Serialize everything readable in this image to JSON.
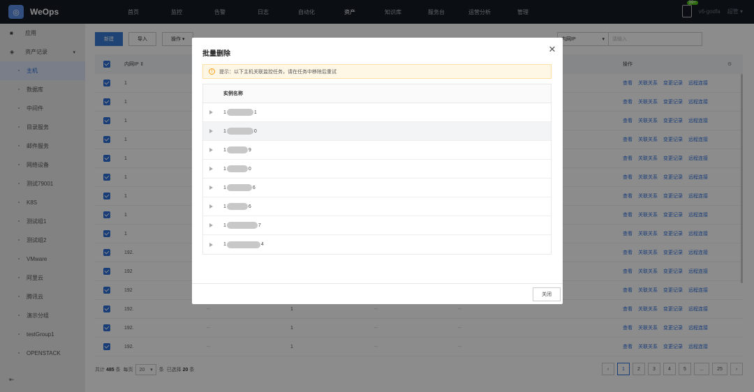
{
  "app": {
    "name": "WeOps"
  },
  "nav": [
    "首页",
    "监控",
    "告警",
    "日志",
    "自动化",
    "资产",
    "知识库",
    "服务台",
    "运营分析",
    "管理"
  ],
  "nav_active_index": 5,
  "topbar": {
    "badge": "99+",
    "user": "v6-godfa",
    "admin": "超管"
  },
  "sidebar": {
    "apps": "应用",
    "group": "资产记录",
    "items": [
      "主机",
      "数据库",
      "中间件",
      "目录服务",
      "邮件服务",
      "网络设备",
      "测试79001",
      "K8S",
      "测试组1",
      "测试组2",
      "VMware",
      "阿里云",
      "腾讯云",
      "演示分组",
      "testGroup1",
      "OPENSTACK"
    ],
    "active_index": 0
  },
  "toolbar": {
    "new": "新建",
    "import": "导入",
    "ops": "操作"
  },
  "filter": {
    "field": "内网IP",
    "placeholder": "请输入"
  },
  "table": {
    "col_ip": "内网IP",
    "col_op": "操作",
    "ops": [
      "查看",
      "关联关系",
      "变更记录",
      "远程连接"
    ],
    "rows": [
      {
        "ip": "1",
        "c3": "",
        "c4": "",
        "c5": "",
        "c6": ""
      },
      {
        "ip": "1",
        "c3": "",
        "c4": "",
        "c5": "",
        "c6": ""
      },
      {
        "ip": "1",
        "c3": "",
        "c4": "",
        "c5": "",
        "c6": ""
      },
      {
        "ip": "1",
        "c3": "",
        "c4": "",
        "c5": "",
        "c6": ""
      },
      {
        "ip": "1",
        "c3": "",
        "c4": "",
        "c5": "",
        "c6": ""
      },
      {
        "ip": "1",
        "c3": "",
        "c4": "",
        "c5": "",
        "c6": ""
      },
      {
        "ip": "1",
        "c3": "",
        "c4": "",
        "c5": "",
        "c6": ""
      },
      {
        "ip": "1",
        "c3": "",
        "c4": "",
        "c5": "",
        "c6": ""
      },
      {
        "ip": "1",
        "c3": "",
        "c4": "",
        "c5": "",
        "c6": ""
      },
      {
        "ip": "192.",
        "c3": "",
        "c4": "",
        "c5": "",
        "c6": ""
      },
      {
        "ip": "192",
        "c3": "",
        "c4": "",
        "c5": "",
        "c6": ""
      },
      {
        "ip": "192",
        "c3": "",
        "c4": "",
        "c5": "",
        "c6": ""
      },
      {
        "ip": "192.",
        "c3": "--",
        "c4": "1",
        "c5": "--",
        "c6": "--"
      },
      {
        "ip": "192.",
        "c3": "--",
        "c4": "1",
        "c5": "--",
        "c6": "--"
      },
      {
        "ip": "192.",
        "c3": "--",
        "c4": "1",
        "c5": "--",
        "c6": "--"
      }
    ]
  },
  "footer": {
    "total_prefix": "共计",
    "total": "485",
    "total_suffix": "条",
    "per_page_label": "每页",
    "per_page": "20",
    "per_page_suffix": "条",
    "selected_prefix": "已选择",
    "selected": "20",
    "selected_suffix": "条"
  },
  "pagination": {
    "pages": [
      "1",
      "2",
      "3",
      "4",
      "5",
      "...",
      "25"
    ],
    "active": "1"
  },
  "modal": {
    "title": "批量删除",
    "notice": "提示：以下主机关联监控任务，请在任务中移除后重试",
    "column": "实例名称",
    "rows": [
      {
        "prefix": "1",
        "suffix": "1",
        "blur": 38
      },
      {
        "prefix": "1",
        "suffix": "0",
        "blur": 38
      },
      {
        "prefix": "1",
        "suffix": "9",
        "blur": 30
      },
      {
        "prefix": "1",
        "suffix": "0",
        "blur": 30
      },
      {
        "prefix": "1",
        "suffix": "6",
        "blur": 36
      },
      {
        "prefix": "1",
        "suffix": "6",
        "blur": 30
      },
      {
        "prefix": "1",
        "suffix": "7",
        "blur": 44
      },
      {
        "prefix": "1",
        "suffix": "4",
        "blur": 48
      }
    ],
    "close_label": "关闭"
  },
  "colors": {
    "topbar": "#141a24",
    "primary": "#2f6fd9",
    "warn": "#fa9c16"
  }
}
